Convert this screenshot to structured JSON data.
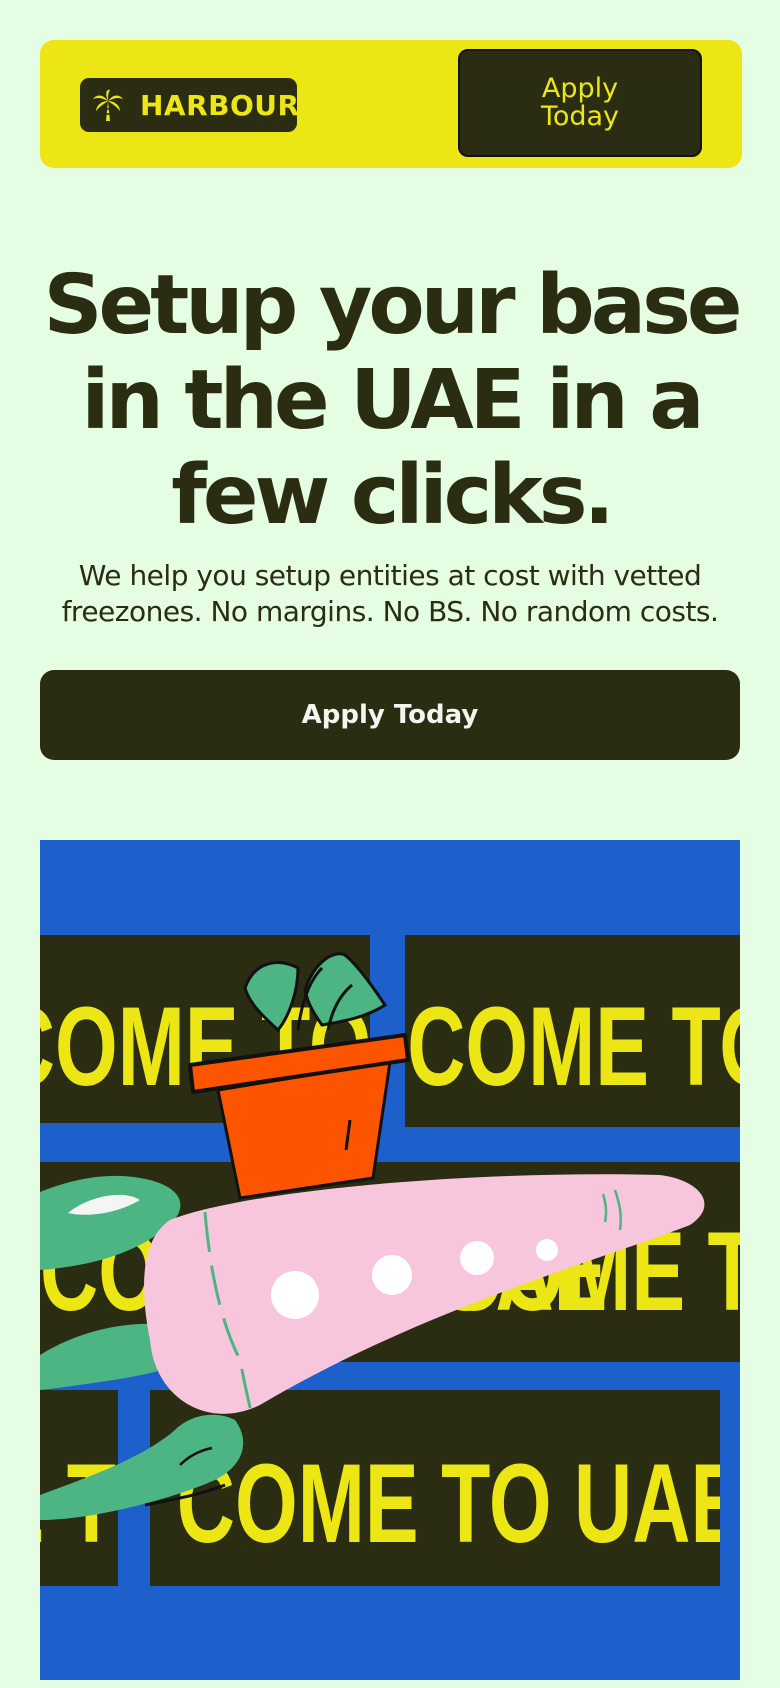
{
  "header": {
    "brand": "HARBOUR",
    "logo_icon": "palm-tree-icon",
    "cta_label": "Apply Today"
  },
  "hero": {
    "title": "Setup your base in the UAE in a few clicks.",
    "subtitle": "We help you setup entities at cost with vetted freezones. No margins. No BS. No random costs.",
    "cta_label": "Apply Today"
  },
  "illustration": {
    "banner_text": "COME TO UAE"
  },
  "colors": {
    "background": "#e5fde3",
    "accent_yellow": "#ebe614",
    "dark": "#2b2d12",
    "illustration_blue": "#1d5fcb",
    "carrot_pink": "#f7c6dc",
    "leaf_green": "#4db484",
    "pot_orange": "#fd5400"
  }
}
